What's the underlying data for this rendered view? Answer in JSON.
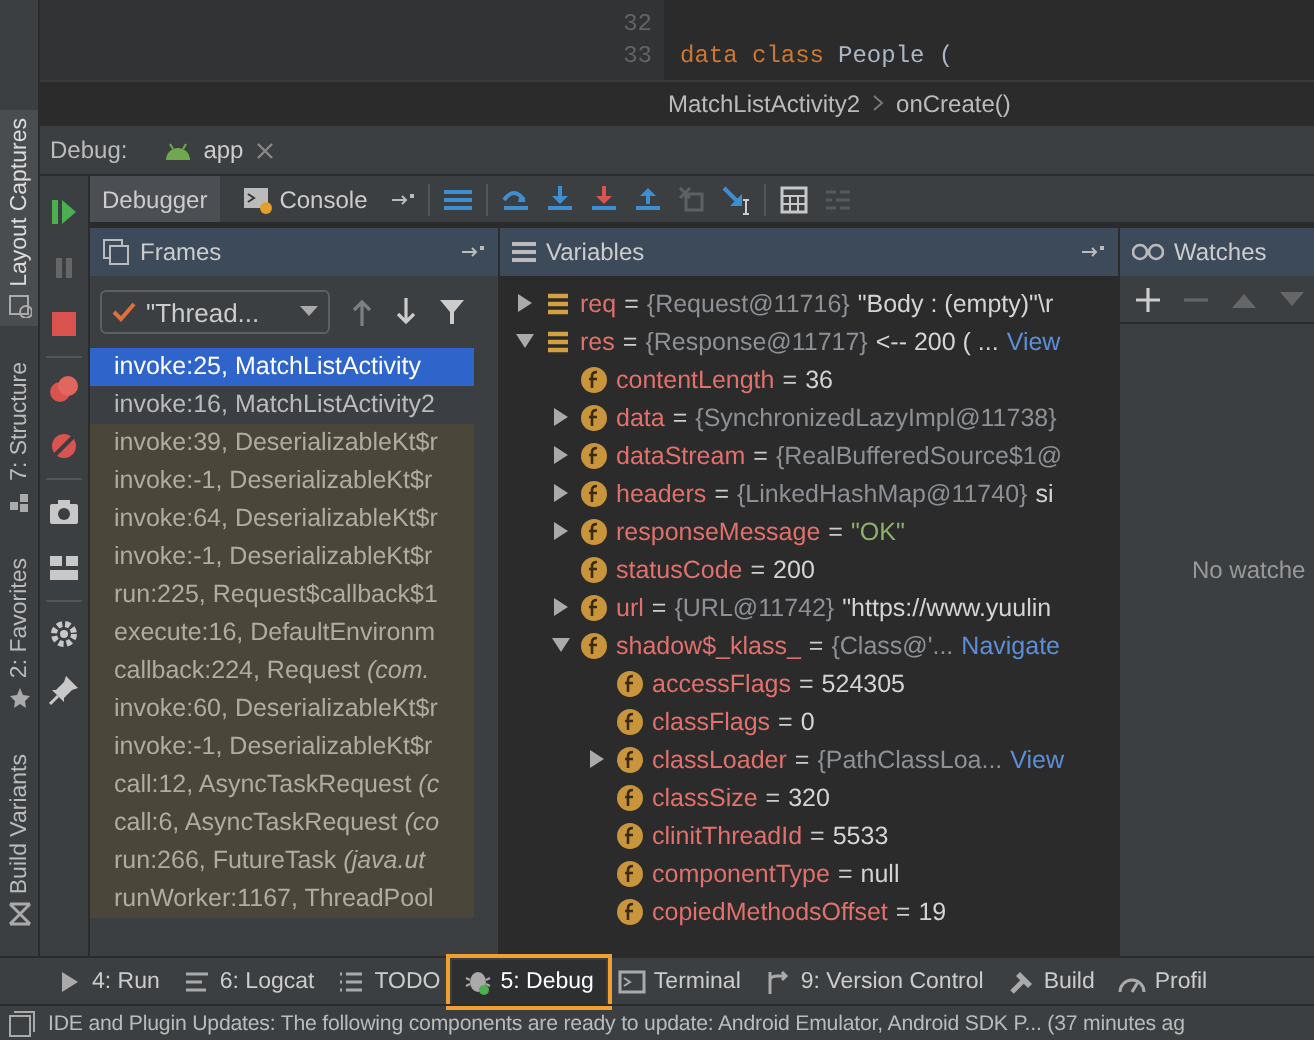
{
  "editor": {
    "lines": [
      {
        "number": "32"
      },
      {
        "number": "33",
        "code": [
          {
            "kind": "keyword",
            "text": "data class"
          },
          {
            "kind": "plain",
            "text": "People ("
          }
        ]
      }
    ],
    "breadcrumb": [
      "MatchListActivity2",
      "onCreate()"
    ]
  },
  "left_strip": [
    {
      "label": "Layout Captures",
      "selected": true
    },
    {
      "label": "7: Structure",
      "selected": false
    },
    {
      "label": "2: Favorites",
      "selected": false
    },
    {
      "label": "Build Variants",
      "selected": false
    }
  ],
  "debug": {
    "label": "Debug:",
    "session_tab": "app",
    "tabs": [
      {
        "label": "Debugger",
        "selected": true
      },
      {
        "label": "Console",
        "selected": false
      }
    ],
    "actions": [
      {
        "disabled": false
      },
      {
        "disabled": false
      },
      {
        "disabled": false
      },
      {
        "disabled": false
      },
      {
        "disabled": true
      },
      {
        "disabled": false
      },
      {
        "disabled": false
      },
      {
        "disabled": true
      }
    ]
  },
  "frames": {
    "title": "Frames",
    "thread": "\"Thread...",
    "nav": [
      {
        "disabled": true
      },
      {
        "disabled": false
      }
    ],
    "items": [
      {
        "text": "invoke:25, MatchListActivity",
        "selected": true,
        "library": false
      },
      {
        "text": "invoke:16, MatchListActivity2",
        "selected": false,
        "library": false
      },
      {
        "text": "invoke:39, DeserializableKt$r",
        "selected": false,
        "library": true
      },
      {
        "text": "invoke:-1, DeserializableKt$r",
        "selected": false,
        "library": true
      },
      {
        "text": "invoke:64, DeserializableKt$r",
        "selected": false,
        "library": true
      },
      {
        "text": "invoke:-1, DeserializableKt$r",
        "selected": false,
        "library": true
      },
      {
        "text": "run:225, Request$callback$1",
        "selected": false,
        "library": true
      },
      {
        "text": "execute:16, DefaultEnvironm",
        "selected": false,
        "library": true
      },
      {
        "text": "callback:224, Request *(com.*",
        "selected": false,
        "library": true
      },
      {
        "text": "invoke:60, DeserializableKt$r",
        "selected": false,
        "library": true
      },
      {
        "text": "invoke:-1, DeserializableKt$r",
        "selected": false,
        "library": true
      },
      {
        "text": "call:12, AsyncTaskRequest *(c*",
        "selected": false,
        "library": true
      },
      {
        "text": "call:6, AsyncTaskRequest *(co*",
        "selected": false,
        "library": true
      },
      {
        "text": "run:266, FutureTask *(java.ut*",
        "selected": false,
        "library": true
      },
      {
        "text": "runWorker:1167, ThreadPool",
        "selected": false,
        "library": true
      }
    ]
  },
  "variables": {
    "title": "Variables",
    "items": [
      {
        "kind": "local",
        "name": "req",
        "sep": "=",
        "ref": "{Request@11716}",
        "value": "\"Body : (empty)\"\\r",
        "string_value": false,
        "expanded": false
      },
      {
        "kind": "local",
        "name": "res",
        "sep": "=",
        "ref": "{Response@11717}",
        "value": "<-- 200 ( ...",
        "string_value": false,
        "link": "View",
        "expanded": true,
        "children": [
          {
            "kind": "field",
            "name": "contentLength",
            "sep": "=",
            "value": "36",
            "string_value": false
          },
          {
            "kind": "field",
            "name": "data",
            "sep": "=",
            "ref": "{SynchronizedLazyImpl@11738}",
            "expanded": false
          },
          {
            "kind": "field",
            "name": "dataStream",
            "sep": "=",
            "ref": "{RealBufferedSource$1@",
            "expanded": false
          },
          {
            "kind": "field",
            "name": "headers",
            "sep": "=",
            "ref": "{LinkedHashMap@11740}",
            "value": "si",
            "string_value": false,
            "expanded": false
          },
          {
            "kind": "field",
            "name": "responseMessage",
            "sep": "=",
            "value": "\"OK\"",
            "string_value": true,
            "expanded": false
          },
          {
            "kind": "field",
            "name": "statusCode",
            "sep": "=",
            "value": "200",
            "string_value": false
          },
          {
            "kind": "field",
            "name": "url",
            "sep": "=",
            "ref": "{URL@11742}",
            "value": "\"https://www.yuulin",
            "string_value": false,
            "expanded": false
          },
          {
            "kind": "field",
            "name": "shadow$_klass_",
            "sep": "=",
            "ref": "{Class@'...",
            "link": "Navigate",
            "expanded": true,
            "children": [
              {
                "kind": "field",
                "name": "accessFlags",
                "sep": "=",
                "value": "524305",
                "string_value": false
              },
              {
                "kind": "field",
                "name": "classFlags",
                "sep": "=",
                "value": "0",
                "string_value": false
              },
              {
                "kind": "field",
                "name": "classLoader",
                "sep": "=",
                "ref": "{PathClassLoa...",
                "link": "View",
                "expanded": false
              },
              {
                "kind": "field",
                "name": "classSize",
                "sep": "=",
                "value": "320",
                "string_value": false
              },
              {
                "kind": "field",
                "name": "clinitThreadId",
                "sep": "=",
                "value": "5533",
                "string_value": false
              },
              {
                "kind": "field",
                "name": "componentType",
                "sep": "=",
                "value": "null",
                "string_value": false
              },
              {
                "kind": "field",
                "name": "copiedMethodsOffset",
                "sep": "=",
                "value": "19",
                "string_value": false
              }
            ]
          }
        ]
      }
    ]
  },
  "watches": {
    "title": "Watches",
    "empty_text": "No watche"
  },
  "bottom_tabs": [
    {
      "label": "4: Run",
      "selected": false
    },
    {
      "label": "6: Logcat",
      "selected": false
    },
    {
      "label": "TODO",
      "selected": false
    },
    {
      "label": "5: Debug",
      "selected": true
    },
    {
      "label": "Terminal",
      "selected": false
    },
    {
      "label": "9: Version Control",
      "selected": false
    },
    {
      "label": "Build",
      "selected": false
    },
    {
      "label": "Profil",
      "selected": false
    }
  ],
  "status_bar": "IDE and Plugin Updates: The following components are ready to update: Android Emulator, Android SDK P... (37 minutes ag"
}
